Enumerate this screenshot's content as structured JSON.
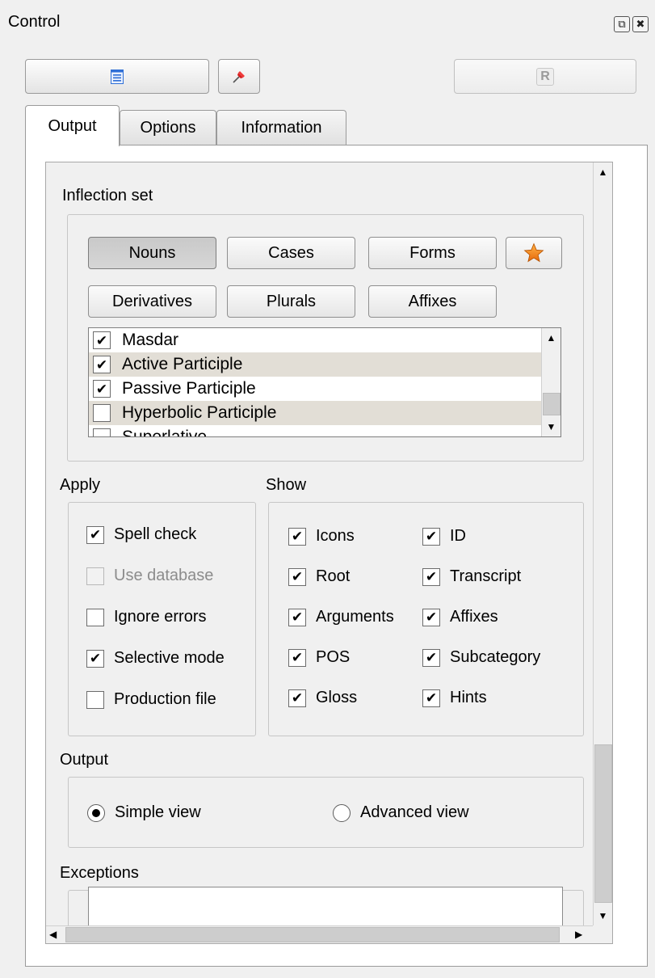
{
  "window": {
    "title": "Control",
    "float_icon": "float-icon",
    "close_icon": "close-icon"
  },
  "toolbar": {
    "buttons": [
      {
        "name": "document-list",
        "icon": "document-list-icon"
      },
      {
        "name": "pin",
        "icon": "pin-icon"
      },
      {
        "name": "r",
        "label": "R",
        "enabled": false
      }
    ]
  },
  "tabs": [
    {
      "label": "Output",
      "active": true
    },
    {
      "label": "Options",
      "active": false
    },
    {
      "label": "Information",
      "active": false
    }
  ],
  "inflection_set": {
    "title": "Inflection set",
    "buttons_row1": [
      "Nouns",
      "Cases",
      "Forms"
    ],
    "pressed": "Nouns",
    "star_icon": "star-icon",
    "buttons_row2": [
      "Derivatives",
      "Plurals",
      "Affixes"
    ],
    "list": [
      {
        "label": "Masdar",
        "checked": true
      },
      {
        "label": "Active Participle",
        "checked": true
      },
      {
        "label": "Passive Participle",
        "checked": true
      },
      {
        "label": "Hyperbolic Participle",
        "checked": false
      },
      {
        "label": "Superlative",
        "checked": false
      }
    ]
  },
  "apply": {
    "title": "Apply",
    "options": [
      {
        "label": "Spell check",
        "checked": true,
        "enabled": true
      },
      {
        "label": "Use database",
        "checked": false,
        "enabled": false
      },
      {
        "label": "Ignore errors",
        "checked": false,
        "enabled": true
      },
      {
        "label": "Selective mode",
        "checked": true,
        "enabled": true
      },
      {
        "label": "Production file",
        "checked": false,
        "enabled": true
      }
    ]
  },
  "show": {
    "title": "Show",
    "col1": [
      {
        "label": "Icons",
        "checked": true
      },
      {
        "label": "Root",
        "checked": true
      },
      {
        "label": "Arguments",
        "checked": true
      },
      {
        "label": "POS",
        "checked": true
      },
      {
        "label": "Gloss",
        "checked": true
      }
    ],
    "col2": [
      {
        "label": "ID",
        "checked": true
      },
      {
        "label": "Transcript",
        "checked": true
      },
      {
        "label": "Affixes",
        "checked": true
      },
      {
        "label": "Subcategory",
        "checked": true
      },
      {
        "label": "Hints",
        "checked": true
      }
    ]
  },
  "output": {
    "title": "Output",
    "options": [
      {
        "label": "Simple view",
        "selected": true
      },
      {
        "label": "Advanced view",
        "selected": false
      }
    ]
  },
  "exceptions": {
    "title": "Exceptions",
    "value": ""
  },
  "check_mark": "✔"
}
